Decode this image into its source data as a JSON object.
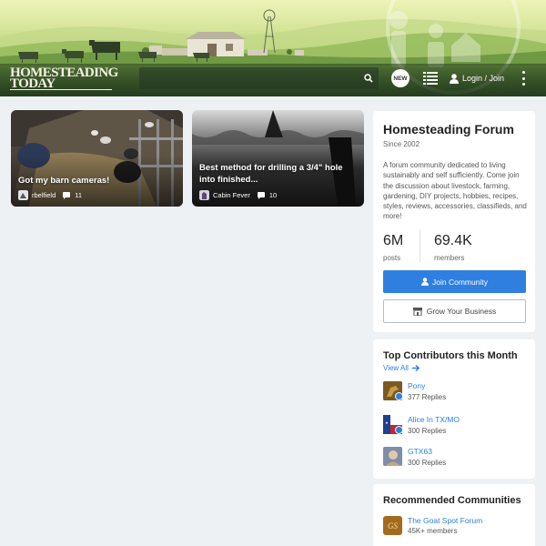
{
  "header": {
    "logo_line1": "HOMESTEADING",
    "logo_line2": "TODAY",
    "search_placeholder": "",
    "new_label": "NEW",
    "login_label": "Login / Join"
  },
  "threads": [
    {
      "title": "Got my barn cameras!",
      "author": "rbelfield",
      "replies": "11"
    },
    {
      "title": "Best method for drilling a 3/4\" hole into finished...",
      "author": "Cabin Fever",
      "replies": "10"
    }
  ],
  "about": {
    "title": "Homesteading Forum",
    "since": "Since 2002",
    "description": "A forum community dedicated to living sustainably and self sufficiently. Come join the discussion about livestock, farming, gardening, DIY projects, hobbies, recipes, styles, reviews, accessories, classifieds, and more!",
    "posts_value": "6M",
    "posts_label": "posts",
    "members_value": "69.4K",
    "members_label": "members",
    "join_label": "Join Community",
    "grow_label": "Grow Your Business"
  },
  "contributors": {
    "title": "Top Contributors this Month",
    "view_all": "View All",
    "people": [
      {
        "name": "Pony",
        "replies": "377 Replies"
      },
      {
        "name": "Alice In TX/MO",
        "replies": "300 Replies"
      },
      {
        "name": "GTX63",
        "replies": "300 Replies"
      }
    ]
  },
  "recommended": {
    "title": "Recommended Communities",
    "items": [
      {
        "name": "The Goat Spot Forum",
        "members": "45K+ members",
        "logo_text": "GS"
      }
    ]
  },
  "colors": {
    "accent": "#2e7fe0",
    "page_bg": "#eef1f4"
  }
}
